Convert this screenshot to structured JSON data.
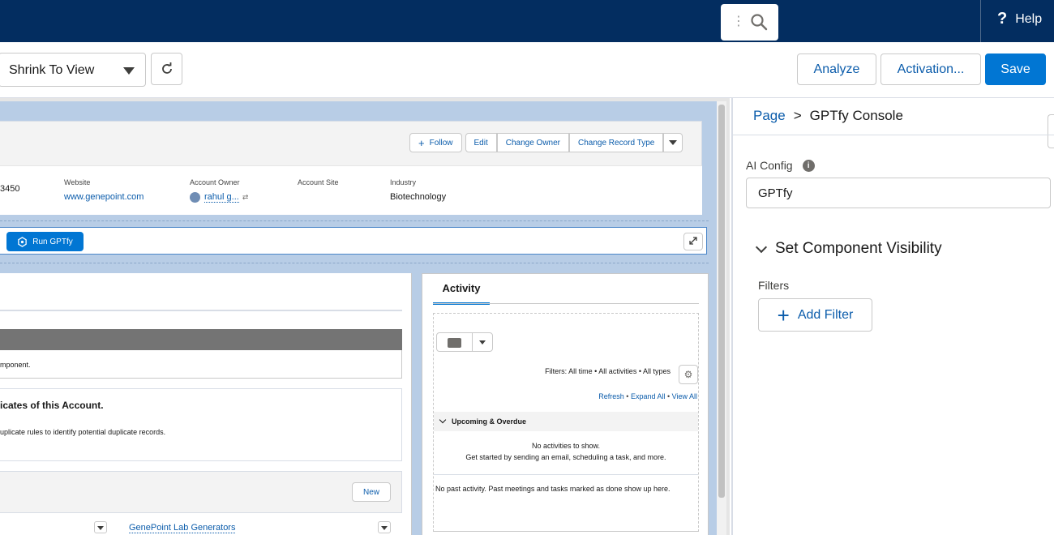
{
  "topbar": {
    "help_label": "Help",
    "help_icon": "?"
  },
  "toolbar": {
    "view_select": "Shrink To View",
    "analyze": "Analyze",
    "activation": "Activation...",
    "save": "Save"
  },
  "record": {
    "actions": {
      "follow": "Follow",
      "edit": "Edit",
      "change_owner": "Change Owner",
      "change_record_type": "Change Record Type"
    },
    "fields": [
      {
        "label": "",
        "value": "3450"
      },
      {
        "label": "Website",
        "value": "www.genepoint.com"
      },
      {
        "label": "Account Owner",
        "value": "rahul g..."
      },
      {
        "label": "Account Site",
        "value": ""
      },
      {
        "label": "Industry",
        "value": "Biotechnology"
      }
    ],
    "run_gptfy": "Run GPTfy"
  },
  "left": {
    "component_msg": "mponent.",
    "dup_title": "icates of this Account.",
    "dup_desc": "uplicate rules to identify potential duplicate records.",
    "new_button": "New",
    "related_link": "GenePoint Lab Generators"
  },
  "activity": {
    "tab": "Activity",
    "filters": "Filters: All time • All activities • All types",
    "refresh": "Refresh",
    "expand_all": "Expand All",
    "view_all": "View All",
    "upcoming": "Upcoming & Overdue",
    "no_activities": "No activities to show.",
    "get_started": "Get started by sending an email, scheduling a task, and more.",
    "past": "No past activity. Past meetings and tasks marked as done show up here."
  },
  "panel": {
    "crumb_page": "Page",
    "crumb_sep": ">",
    "crumb_current": "GPTfy Console",
    "ai_config_label": "AI Config",
    "ai_config_value": "GPTfy",
    "visibility_heading": "Set Component Visibility",
    "filters_label": "Filters",
    "add_filter": "Add Filter"
  }
}
